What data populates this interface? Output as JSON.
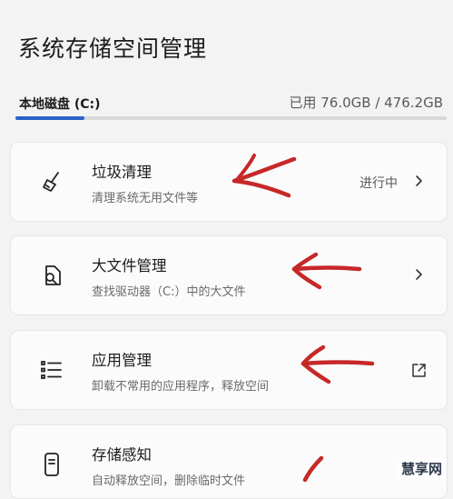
{
  "page": {
    "title": "系统存储空间管理"
  },
  "disk": {
    "label": "本地磁盘 (C:)",
    "usage": "已用 76.0GB / 476.2GB",
    "used_fraction": 0.16
  },
  "cards": [
    {
      "title": "垃圾清理",
      "subtitle": "清理系统无用文件等",
      "status": "进行中",
      "icon": "broom-icon",
      "action": "chevron-right-icon"
    },
    {
      "title": "大文件管理",
      "subtitle": "查找驱动器（C:）中的大文件",
      "icon": "file-search-icon",
      "action": "chevron-right-icon"
    },
    {
      "title": "应用管理",
      "subtitle": "卸载不常用的应用程序，释放空间",
      "icon": "list-icon",
      "action": "external-link-icon"
    },
    {
      "title": "存储感知",
      "subtitle": "自动释放空间，删除临时文件",
      "icon": "phone-storage-icon"
    }
  ],
  "annotation_color": "#c62828",
  "watermark": "慧享网"
}
